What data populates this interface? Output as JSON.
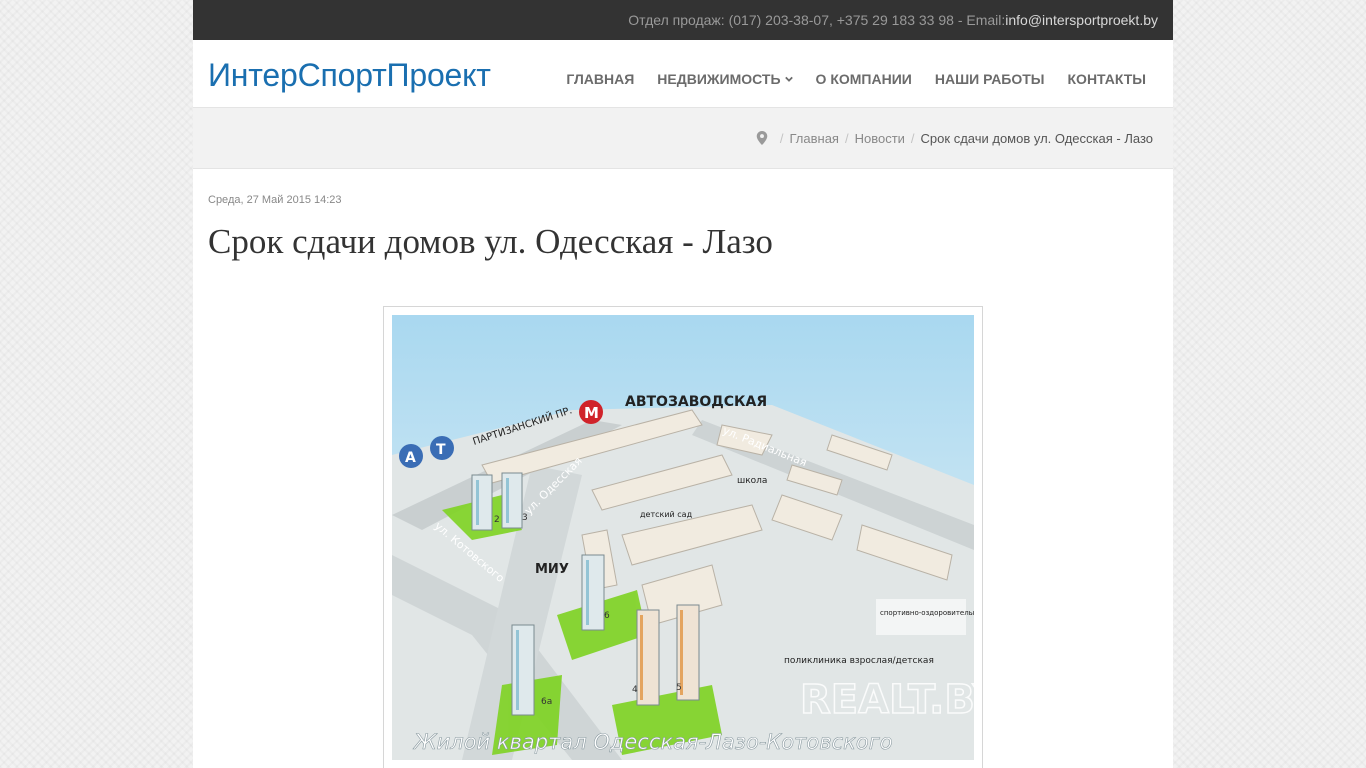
{
  "topbar": {
    "contact_text": "Отдел продаж: (017) 203-38-07, +375 29 183 33 98 - Email: ",
    "email": "info@intersportproekt.by"
  },
  "header": {
    "logo": "ИнтерСпортПроект",
    "nav": [
      {
        "label": "ГЛАВНАЯ"
      },
      {
        "label": "НЕДВИЖИМОСТЬ",
        "has_dropdown": true
      },
      {
        "label": "О КОМПАНИИ"
      },
      {
        "label": "НАШИ РАБОТЫ"
      },
      {
        "label": "КОНТАКТЫ"
      }
    ]
  },
  "breadcrumb": {
    "icon": "map-marker-icon",
    "items": [
      "Главная",
      "Новости"
    ],
    "current": "Срок сдачи домов ул. Одесская - Лазо"
  },
  "article": {
    "date": "Среда, 27 Май 2015 14:23",
    "title": "Срок сдачи домов ул. Одесская - Лазо"
  },
  "map_image": {
    "labels": {
      "metro": "М",
      "station": "АВТОЗАВОДСКАЯ",
      "partizansky": "ПАРТИЗАНСКИЙ ПР.",
      "radialnaya": "ул. Радиальная",
      "odesskaya": "ул. Одесская",
      "kotovskogo": "ул. Котовского",
      "shkola": "школа",
      "detsad": "детский сад",
      "miu": "МИУ",
      "sport": "спортивно-оздоровительный комплекс",
      "poliklinika": "поликлиника взрослая/детская",
      "bus": "А",
      "tram": "Т",
      "caption": "Жилой квартал Одесская-Лазо-Котовского",
      "watermark": "REALT.BY",
      "b2": "2",
      "b3": "3",
      "b4": "4",
      "b5": "5",
      "b6": "6",
      "b6a": "6а"
    },
    "colors": {
      "sky": "#a9d8f0",
      "ground": "#e7edee",
      "green": "#7ed321",
      "metro": "#d0232a",
      "transport": "#3a6db5"
    }
  }
}
